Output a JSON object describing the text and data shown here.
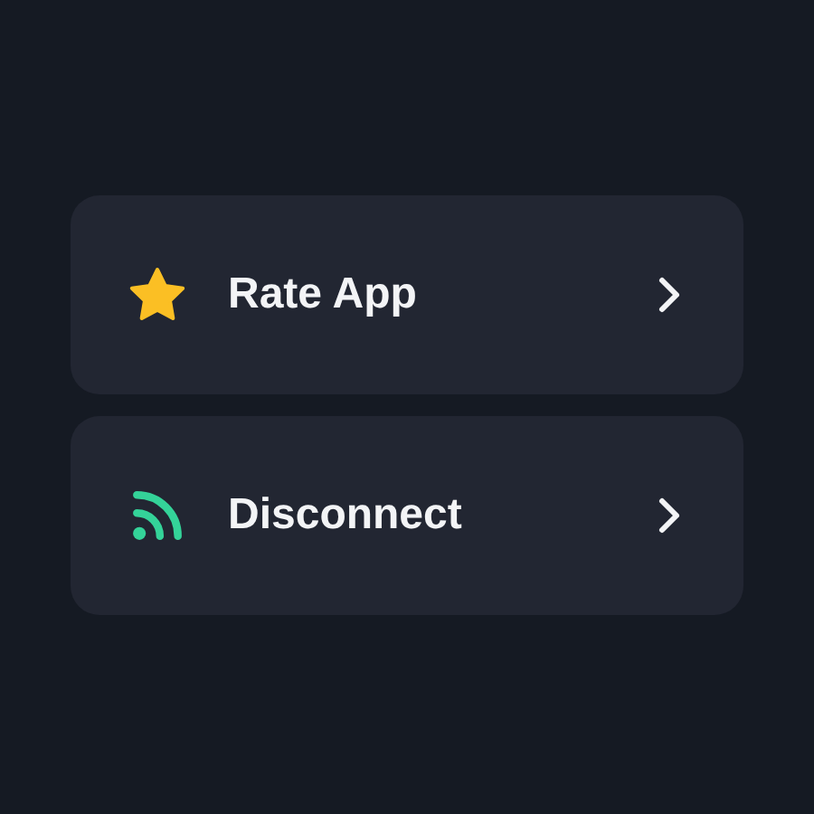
{
  "menu": [
    {
      "kind": "star",
      "label": "Rate App"
    },
    {
      "kind": "rss",
      "label": "Disconnect"
    }
  ]
}
